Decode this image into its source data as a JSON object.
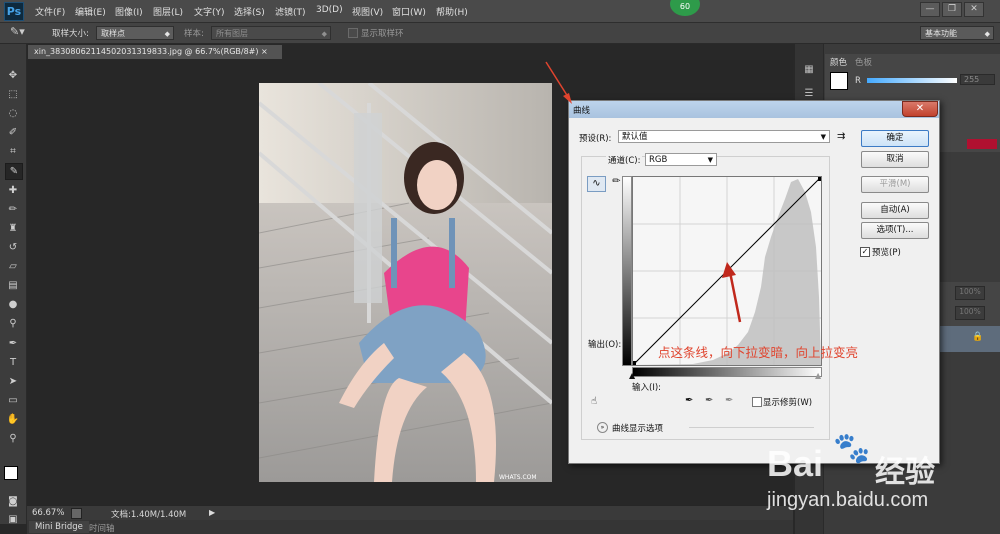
{
  "menubar": {
    "logo": "Ps",
    "items": [
      "文件(F)",
      "编辑(E)",
      "图像(I)",
      "图层(L)",
      "文字(Y)",
      "选择(S)",
      "滤镜(T)",
      "3D(D)",
      "视图(V)",
      "窗口(W)",
      "帮助(H)"
    ],
    "badge": "60",
    "window_buttons": [
      "—",
      "❐",
      "✕"
    ]
  },
  "options": {
    "sample_size_label": "取样大小:",
    "sample_size_value": "取样点",
    "sample_label": "样本:",
    "sample_value": "所有图层",
    "show_ring_label": "显示取样环",
    "workspace": "基本功能"
  },
  "document": {
    "tab_title": "xin_38308062114502031319833.jpg @ 66.7%(RGB/8#)",
    "zoom": "66.67%",
    "doc_info": "文档:1.40M/1.40M",
    "photo_watermark": "WHATS.COM"
  },
  "bottom_tabs": [
    "Mini Bridge",
    "时间轴"
  ],
  "panels": {
    "color_tabs": [
      "颜色",
      "色板"
    ],
    "r_label": "R",
    "r_value": "255",
    "layer_opacity": "100%",
    "layer_fill": "100%"
  },
  "dialog": {
    "title": "曲线",
    "preset_label": "预设(R):",
    "preset_value": "默认值",
    "channel_label": "通道(C):",
    "channel_value": "RGB",
    "output_label": "输出(O):",
    "input_label": "输入(I):",
    "show_clipping_label": "显示修剪(W)",
    "display_options_label": "曲线显示选项",
    "buttons": {
      "ok": "确定",
      "cancel": "取消",
      "smooth": "平滑(M)",
      "auto": "自动(A)",
      "options": "选项(T)...",
      "preview": "预览(P)"
    },
    "preview_checked": true
  },
  "annotation": "点这条线，向下拉变暗，向上拉变亮",
  "watermark": {
    "brand": "Bai",
    "brand_cn": "经验",
    "url": "jingyan.baidu.com"
  },
  "colors": {
    "accent_red": "#e0442e",
    "dialog_title_bg": "#a9c3df",
    "photo_pink_shirt": "#e8458c"
  }
}
